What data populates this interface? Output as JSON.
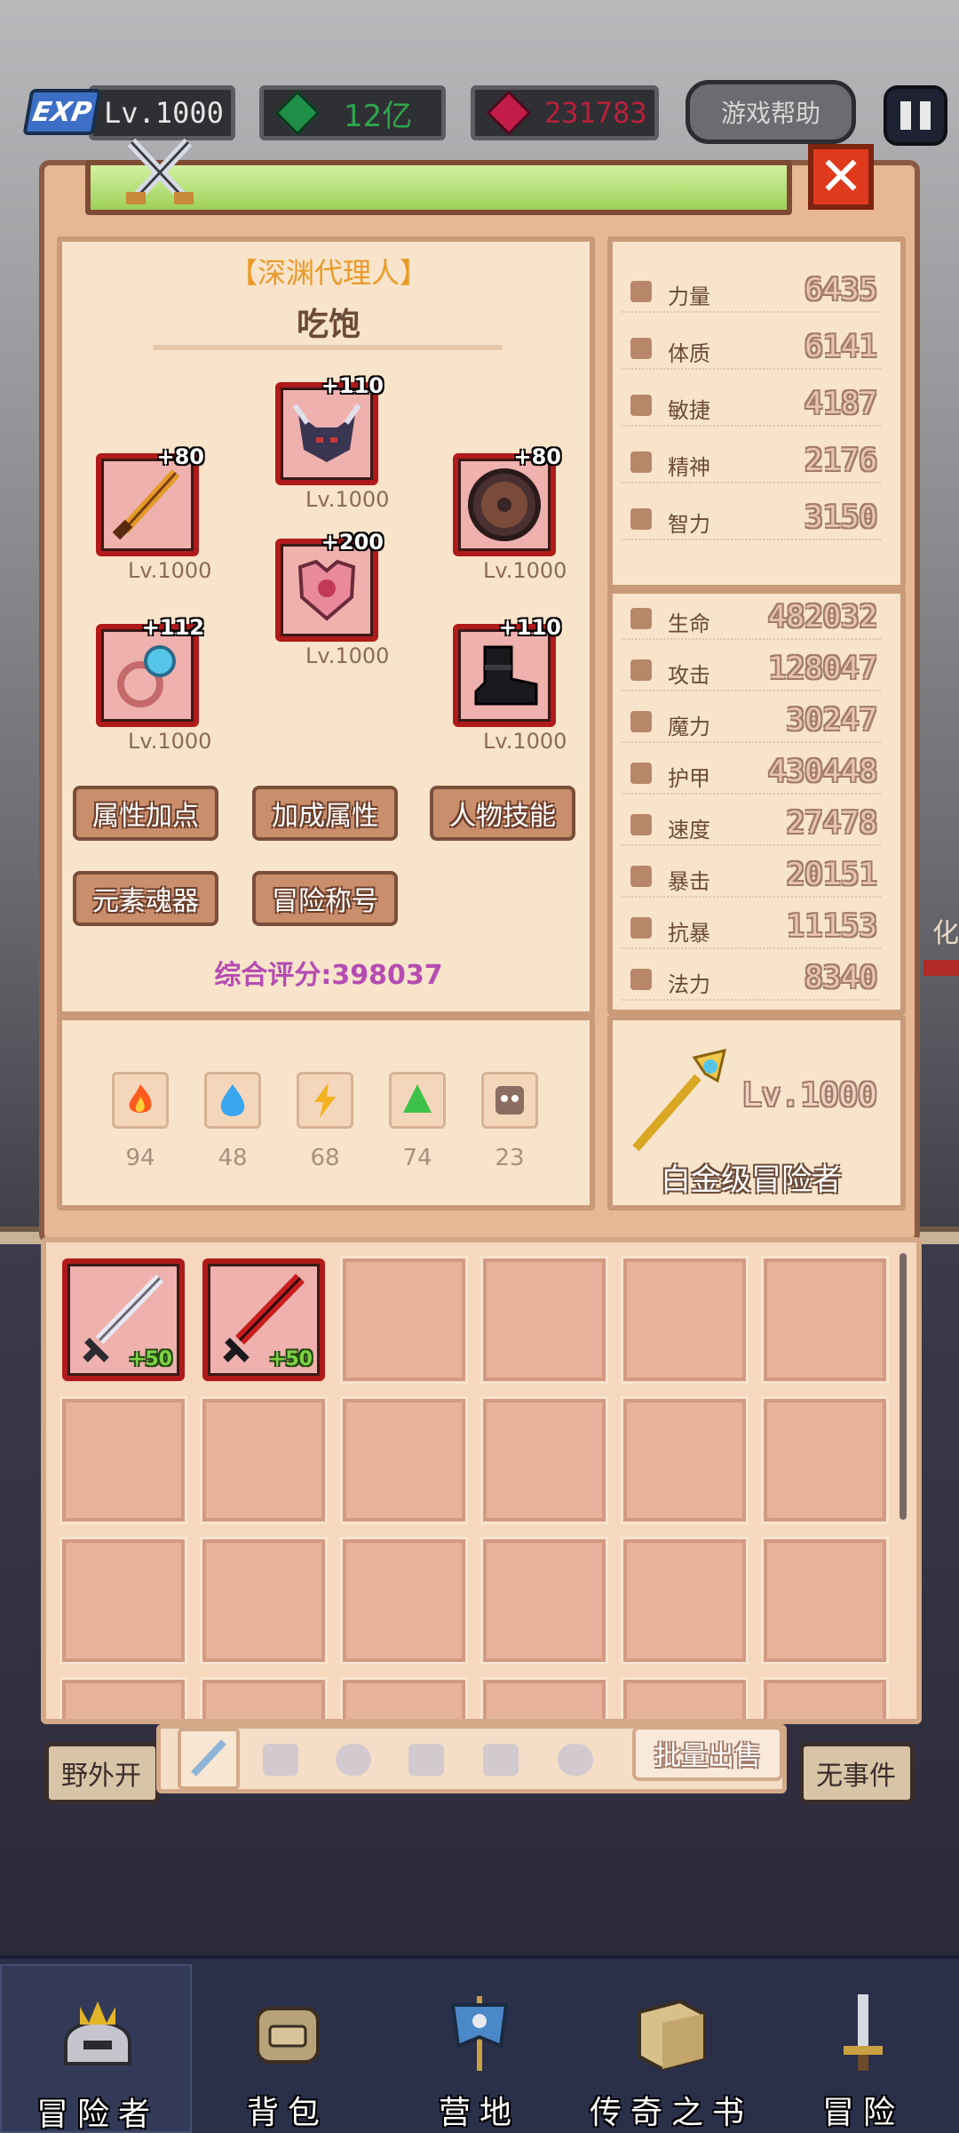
{
  "hud": {
    "exp_label": "EXP",
    "level": "Lv.1000",
    "currency_green": "12亿",
    "currency_red": "231783",
    "help_label": "游戏帮助"
  },
  "character": {
    "title": "【深渊代理人】",
    "name": "吃饱",
    "score": "综合评分:398037"
  },
  "equipment": [
    {
      "slot": "helmet",
      "plus": "+110",
      "level": "Lv.1000",
      "icon": "demon-helmet-icon"
    },
    {
      "slot": "weapon",
      "plus": "+80",
      "level": "Lv.1000",
      "icon": "golden-sword-icon"
    },
    {
      "slot": "shield",
      "plus": "+80",
      "level": "Lv.1000",
      "icon": "round-shield-icon"
    },
    {
      "slot": "armor",
      "plus": "+200",
      "level": "Lv.1000",
      "icon": "chest-armor-icon"
    },
    {
      "slot": "ring",
      "plus": "+112",
      "level": "Lv.1000",
      "icon": "blue-gem-ring-icon"
    },
    {
      "slot": "boots",
      "plus": "+110",
      "level": "Lv.1000",
      "icon": "black-boots-icon"
    }
  ],
  "actions": {
    "attr_points": "属性加点",
    "bonus_attrs": "加成属性",
    "char_skills": "人物技能",
    "element_soul": "元素魂器",
    "adventure_title": "冒险称号"
  },
  "elements": [
    {
      "name": "fire",
      "value": "94",
      "color": "#ff5a1e"
    },
    {
      "name": "water",
      "value": "48",
      "color": "#3aa6f0"
    },
    {
      "name": "thunder",
      "value": "68",
      "color": "#f3b31e"
    },
    {
      "name": "nature",
      "value": "74",
      "color": "#3cc24a"
    },
    {
      "name": "dark",
      "value": "23",
      "color": "#8a6e62"
    }
  ],
  "base_stats": [
    {
      "label": "力量",
      "value": "6435"
    },
    {
      "label": "体质",
      "value": "6141"
    },
    {
      "label": "敏捷",
      "value": "4187"
    },
    {
      "label": "精神",
      "value": "2176"
    },
    {
      "label": "智力",
      "value": "3150"
    }
  ],
  "combat_stats": [
    {
      "label": "生命",
      "value": "482032"
    },
    {
      "label": "攻击",
      "value": "128047"
    },
    {
      "label": "魔力",
      "value": "30247"
    },
    {
      "label": "护甲",
      "value": "430448"
    },
    {
      "label": "速度",
      "value": "27478"
    },
    {
      "label": "暴击",
      "value": "20151"
    },
    {
      "label": "抗暴",
      "value": "11153"
    },
    {
      "label": "法力",
      "value": "8340"
    }
  ],
  "rank": {
    "level": "Lv.1000",
    "name": "白金级冒险者"
  },
  "inventory": {
    "items": [
      {
        "icon": "silver-sword-icon",
        "bonus": "+50"
      },
      {
        "icon": "crimson-sword-icon",
        "bonus": "+50"
      }
    ],
    "bulk_sell": "批量出售"
  },
  "background": {
    "left_tag": "野外开",
    "right_tag": "无事件",
    "side_word": "化"
  },
  "nav": [
    {
      "label": "冒险者",
      "icon": "adventurer-helmet-icon"
    },
    {
      "label": "背包",
      "icon": "backpack-icon"
    },
    {
      "label": "营地",
      "icon": "camp-banner-icon"
    },
    {
      "label": "传奇之书",
      "icon": "legend-book-icon"
    },
    {
      "label": "冒险",
      "icon": "adventure-sword-icon"
    }
  ],
  "colors": {
    "accent_orange": "#ea9a2a",
    "score_purple": "#b54cb2",
    "slot_red": "#b01a1a"
  }
}
